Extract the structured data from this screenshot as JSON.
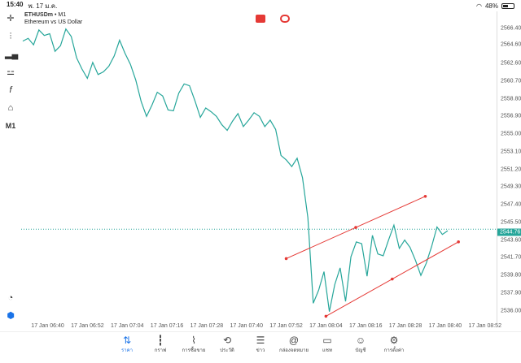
{
  "status_bar": {
    "time": "15:40",
    "date": "พ. 17 ม.ค.",
    "battery": "48%"
  },
  "symbol": {
    "name": "ETHUSDm",
    "timeframe": "M1",
    "description": "Ethereum vs US Dollar"
  },
  "toolbar": {
    "timeframe_label": "M1"
  },
  "price_axis": {
    "labels": [
      "2566.40",
      "2564.60",
      "2562.60",
      "2560.70",
      "2558.80",
      "2556.90",
      "2555.00",
      "2553.10",
      "2551.20",
      "2549.30",
      "2547.40",
      "2545.50",
      "2543.60",
      "2541.70",
      "2539.80",
      "2537.90",
      "2536.00"
    ],
    "current_price": "2544.76"
  },
  "time_axis": {
    "labels": [
      "17 Jan 06:40",
      "17 Jan 06:52",
      "17 Jan 07:04",
      "17 Jan 07:16",
      "17 Jan 07:28",
      "17 Jan 07:40",
      "17 Jan 07:52",
      "17 Jan 08:04",
      "17 Jan 08:16",
      "17 Jan 08:28",
      "17 Jan 08:40",
      "17 Jan 08:52"
    ]
  },
  "bottom_nav": [
    {
      "label": "ราคา",
      "icon": "quotes-icon",
      "active": true
    },
    {
      "label": "กราฟ",
      "icon": "chart-icon",
      "active": false
    },
    {
      "label": "การซื้อขาย",
      "icon": "trade-icon",
      "active": false
    },
    {
      "label": "ประวัติ",
      "icon": "history-icon",
      "active": false
    },
    {
      "label": "ข่าว",
      "icon": "news-icon",
      "active": false
    },
    {
      "label": "กล่องจดหมาย",
      "icon": "mailbox-icon",
      "active": false
    },
    {
      "label": "แชท",
      "icon": "chat-icon",
      "active": false
    },
    {
      "label": "บัญชี",
      "icon": "account-icon",
      "active": false
    },
    {
      "label": "การตั้งค่า",
      "icon": "settings-icon",
      "active": false
    }
  ],
  "colors": {
    "line": "#26a69a",
    "channel": "#e53935",
    "accent": "#1a73e8"
  },
  "chart_data": {
    "type": "line",
    "title": "ETHUSDm, M1",
    "series": [
      {
        "name": "Ethereum vs US Dollar",
        "values": [
          2565.0,
          2565.3,
          2564.6,
          2566.2,
          2565.6,
          2565.8,
          2563.9,
          2564.5,
          2566.3,
          2565.5,
          2563.2,
          2562.0,
          2561.0,
          2562.7,
          2561.4,
          2561.7,
          2562.3,
          2563.4,
          2565.1,
          2563.7,
          2562.5,
          2560.8,
          2558.5,
          2556.9,
          2558.1,
          2559.5,
          2559.1,
          2557.6,
          2557.5,
          2559.4,
          2560.4,
          2560.2,
          2558.6,
          2556.8,
          2557.8,
          2557.4,
          2556.9,
          2556.0,
          2555.4,
          2556.4,
          2557.2,
          2555.8,
          2556.5,
          2557.3,
          2556.9,
          2555.8,
          2556.5,
          2555.5,
          2552.7,
          2552.2,
          2551.5,
          2552.4,
          2550.3,
          2546.0,
          2536.8,
          2538.2,
          2540.2,
          2535.9,
          2538.8,
          2540.6,
          2537.0,
          2541.8,
          2543.4,
          2543.2,
          2539.7,
          2544.1,
          2542.1,
          2541.9,
          2543.6,
          2545.2,
          2542.7,
          2543.6,
          2542.8,
          2541.4,
          2539.8,
          2541.1,
          2542.9,
          2545.0,
          2544.2,
          2544.6
        ]
      }
    ],
    "ylim": [
      2535.0,
      2567.5
    ],
    "xlim": [
      "17 Jan 06:32",
      "17 Jan 08:56"
    ],
    "current_price": 2544.76,
    "channel_lines": [
      {
        "from": [
          "17 Jan 07:52",
          2541.6
        ],
        "to": [
          "17 Jan 08:34",
          2548.3
        ]
      },
      {
        "from": [
          "17 Jan 08:04",
          2535.4
        ],
        "to": [
          "17 Jan 08:44",
          2543.4
        ]
      }
    ]
  }
}
